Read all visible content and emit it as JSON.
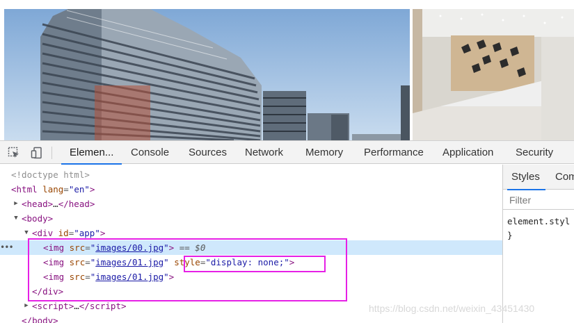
{
  "devtools": {
    "tabs": [
      "Elemen...",
      "Console",
      "Sources",
      "Network",
      "Memory",
      "Performance",
      "Application",
      "Security"
    ],
    "active_tab": "Elemen...",
    "toolbar_icons": [
      "inspect-element-icon",
      "device-toolbar-icon"
    ]
  },
  "elements": {
    "doctype": "<!doctype html>",
    "html_open_tag": "html",
    "html_attr": "lang",
    "html_val": "\"en\"",
    "head_tag": "head",
    "body_tag": "body",
    "div_tag": "div",
    "div_attr": "id",
    "div_val": "\"app\"",
    "img_tag": "img",
    "src_attr": "src",
    "img_src_0": "images/00.jpg",
    "img_src_1": "images/01.jpg",
    "img_src_2": "images/01.jpg",
    "style_attr": "style",
    "style_val": "\"display: none;\"",
    "dollar": "== $0",
    "ellipsis": "…",
    "script_tag": "script"
  },
  "sidebar": {
    "tabs": [
      "Styles",
      "Com"
    ],
    "filter_placeholder": "Filter",
    "element_style_label": "element.styl",
    "closing_brace": "}"
  },
  "watermark": "https://blog.csdn.net/weixin_43451430",
  "colors": {
    "highlight_box": "#e620e6",
    "selected_row": "#cfe8fc",
    "active_tab_underline": "#1a73e8"
  }
}
